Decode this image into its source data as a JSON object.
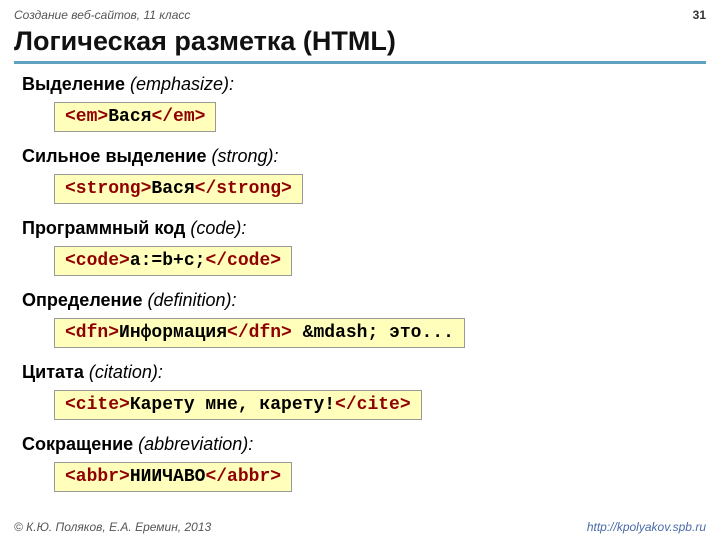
{
  "topbar": {
    "course": "Создание веб-сайтов, 11 класс",
    "page": "31"
  },
  "title": "Логическая разметка (HTML)",
  "sections": [
    {
      "labelBold": "Выделение",
      "hint": " (emphasize):",
      "open": "<em>",
      "content": "Вася",
      "close": "</em>"
    },
    {
      "labelBold": "Сильное выделение",
      "hint": " (strong):",
      "open": "<strong>",
      "content": "Вася",
      "close": "</strong>"
    },
    {
      "labelBold": "Программный код",
      "hint": " (code):",
      "open": "<code>",
      "content": "a:=b+c;",
      "close": "</code>"
    },
    {
      "labelBold": "Определение",
      "hint": " (definition):",
      "open": "<dfn>",
      "content": "Информация",
      "close": "</dfn>",
      "after": " &mdash; это..."
    },
    {
      "labelBold": "Цитата",
      "hint": " (citation):",
      "open": "<cite>",
      "content": "Карету мне, карету!",
      "close": "</cite>"
    },
    {
      "labelBold": "Сокращение",
      "hint": " (abbreviation):",
      "open": "<abbr>",
      "content": "НИИЧАВО",
      "close": "</abbr>"
    }
  ],
  "footer": {
    "copyright": "© К.Ю. Поляков, Е.А. Еремин, 2013",
    "url": "http://kpolyakov.spb.ru"
  }
}
